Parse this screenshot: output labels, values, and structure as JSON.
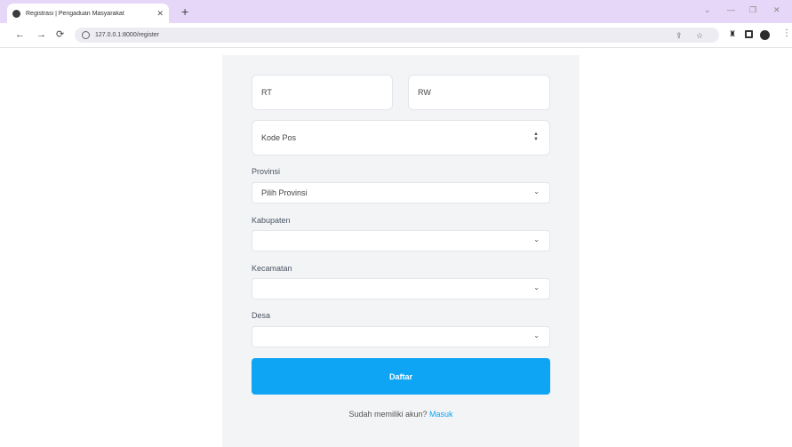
{
  "browser": {
    "tab_title": "Registrasi | Pengaduan Masyarakat",
    "tab_close": "✕",
    "new_tab": "+",
    "url": "127.0.0.1:8000/register",
    "back": "←",
    "forward": "→",
    "reload": "⟳",
    "minimize": "—",
    "restore": "❐",
    "close": "✕"
  },
  "form": {
    "rt": {
      "placeholder": "RT"
    },
    "rw": {
      "placeholder": "RW"
    },
    "kode_pos": {
      "placeholder": "Kode Pos"
    },
    "provinsi": {
      "label": "Provinsi",
      "value": "Pilih Provinsi"
    },
    "kabupaten": {
      "label": "Kabupaten",
      "value": ""
    },
    "kecamatan": {
      "label": "Kecamatan",
      "value": ""
    },
    "desa": {
      "label": "Desa",
      "value": ""
    },
    "submit_label": "Daftar",
    "login_prompt": "Sudah memiliki akun?",
    "login_link": "Masuk"
  },
  "icons": {
    "chevron": "⌄",
    "spinner_up": "▲",
    "spinner_down": "▼"
  }
}
